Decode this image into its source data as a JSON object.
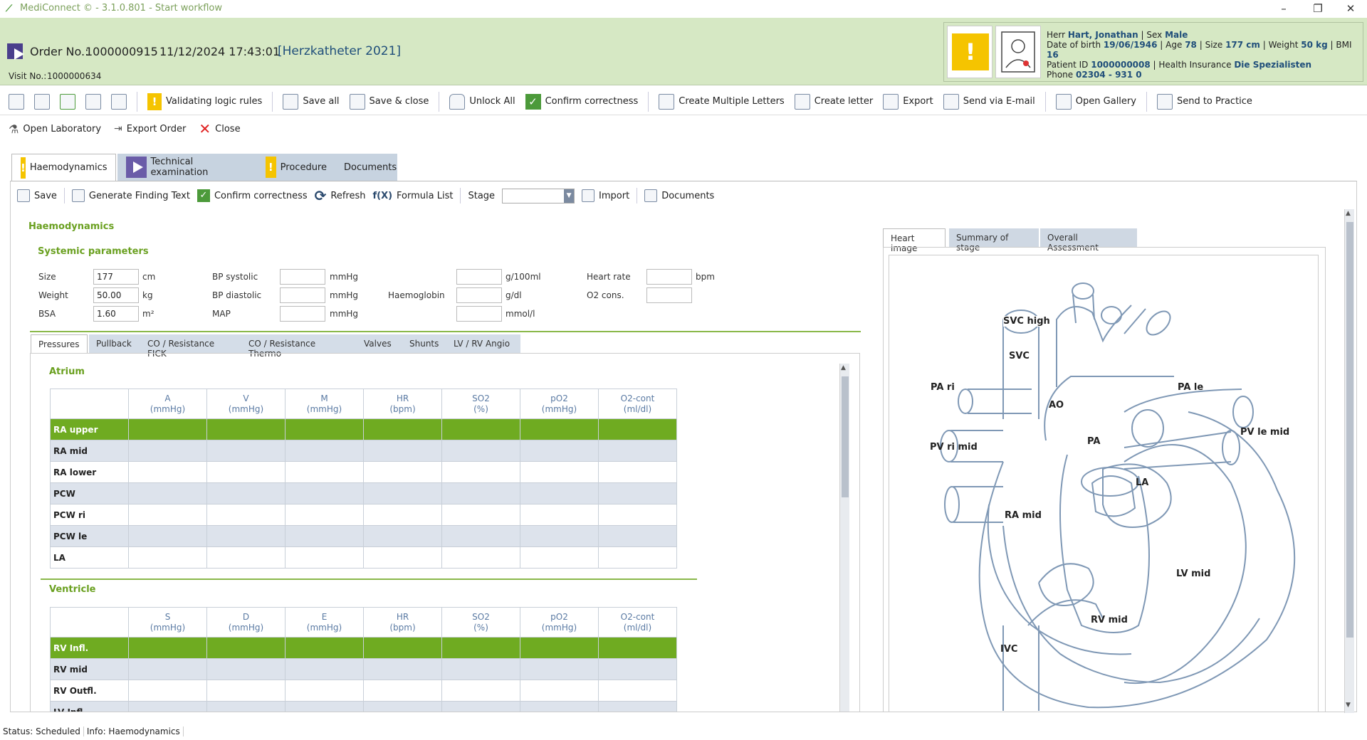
{
  "window": {
    "title": "MediConnect © - 3.1.0.801 - Start workflow",
    "controls": [
      "–",
      "❐",
      "✕"
    ]
  },
  "header": {
    "order_label": "Order No.:",
    "order_no": "1000000915",
    "datetime": "11/12/2024 17:43:01",
    "procedure": "[Herzkatheter 2021]",
    "visit_label": "Visit No.:",
    "visit_no": "1000000634",
    "patient": {
      "salutation": "Herr",
      "name": "Hart, Jonathan",
      "sex_label": "| Sex",
      "sex": "Male",
      "dob_label": "Date of birth",
      "dob": "19/06/1946",
      "age_label": "| Age",
      "age": "78",
      "size_label": "| Size",
      "size": "177 cm",
      "weight_label": "| Weight",
      "weight": "50 kg",
      "bmi_label": "| BMI",
      "bmi": "16",
      "pid_label": "Patient ID",
      "pid": "1000000008",
      "insurance_label": "| Health Insurance",
      "insurance": "Die Spezialisten",
      "phone_label": "Phone",
      "phone": "02304 - 931 0"
    }
  },
  "toolbar1": {
    "validating": "Validating logic rules",
    "save_all": "Save all",
    "save_close": "Save & close",
    "unlock_all": "Unlock All",
    "confirm": "Confirm correctness",
    "multi_letters": "Create Multiple Letters",
    "create_letter": "Create letter",
    "export": "Export",
    "send_email": "Send via E-mail",
    "open_gallery": "Open Gallery",
    "send_practice": "Send to Practice"
  },
  "toolbar2": {
    "open_lab": "Open Laboratory",
    "export_order": "Export Order",
    "close": "Close"
  },
  "main_tabs": [
    "Haemodynamics",
    "Technical examination",
    "Procedure",
    "Documents"
  ],
  "toolbar3": {
    "save": "Save",
    "gen_text": "Generate Finding Text",
    "confirm": "Confirm correctness",
    "refresh": "Refresh",
    "formula": "Formula List",
    "formula_icon": "f(X)",
    "stage": "Stage",
    "import": "Import",
    "documents": "Documents"
  },
  "section": {
    "title": "Haemodynamics",
    "systemic": "Systemic parameters"
  },
  "systemic": {
    "size_label": "Size",
    "size_val": "177",
    "size_unit": "cm",
    "weight_label": "Weight",
    "weight_val": "50.00",
    "weight_unit": "kg",
    "bsa_label": "BSA",
    "bsa_val": "1.60",
    "bsa_unit": "m²",
    "bps_label": "BP systolic",
    "bps_unit": "mmHg",
    "bpd_label": "BP diastolic",
    "bpd_unit": "mmHg",
    "map_label": "MAP",
    "map_unit": "mmHg",
    "hb_label": "Haemoglobin",
    "u1": "g/100ml",
    "u2": "g/dl",
    "u3": "mmol/l",
    "hr_label": "Heart rate",
    "hr_unit": "bpm",
    "o2_label": "O2 cons."
  },
  "sub_tabs": [
    "Pressures",
    "Pullback",
    "CO / Resistance FICK",
    "CO / Resistance Thermo",
    "Valves",
    "Shunts",
    "LV / RV Angio"
  ],
  "atrium": {
    "title": "Atrium",
    "columns": [
      [
        "A",
        "(mmHg)"
      ],
      [
        "V",
        "(mmHg)"
      ],
      [
        "M",
        "(mmHg)"
      ],
      [
        "HR",
        "(bpm)"
      ],
      [
        "SO2",
        "(%)"
      ],
      [
        "pO2",
        "(mmHg)"
      ],
      [
        "O2-cont",
        "(ml/dl)"
      ]
    ],
    "rows": [
      "RA upper",
      "RA mid",
      "RA lower",
      "PCW",
      "PCW ri",
      "PCW le",
      "LA"
    ]
  },
  "ventricle": {
    "title": "Ventricle",
    "columns": [
      [
        "S",
        "(mmHg)"
      ],
      [
        "D",
        "(mmHg)"
      ],
      [
        "E",
        "(mmHg)"
      ],
      [
        "HR",
        "(bpm)"
      ],
      [
        "SO2",
        "(%)"
      ],
      [
        "pO2",
        "(mmHg)"
      ],
      [
        "O2-cont",
        "(ml/dl)"
      ]
    ],
    "rows": [
      "RV Infl.",
      "RV mid",
      "RV Outfl.",
      "LV Infl."
    ]
  },
  "right_tabs": [
    "Heart image",
    "Summary of stage",
    "Overall Assessment"
  ],
  "heart_labels": {
    "svc_high": "SVC high",
    "svc": "SVC",
    "pa_ri": "PA ri",
    "pa_le": "PA le",
    "ao": "AO",
    "pv_le_mid": "PV le mid",
    "pv_ri_mid": "PV ri mid",
    "pa": "PA",
    "la": "LA",
    "ra_mid": "RA mid",
    "lv_mid": "LV mid",
    "rv_mid": "RV mid",
    "ivc": "IVC"
  },
  "status": {
    "status": "Status: Scheduled",
    "info": "Info: Haemodynamics"
  }
}
